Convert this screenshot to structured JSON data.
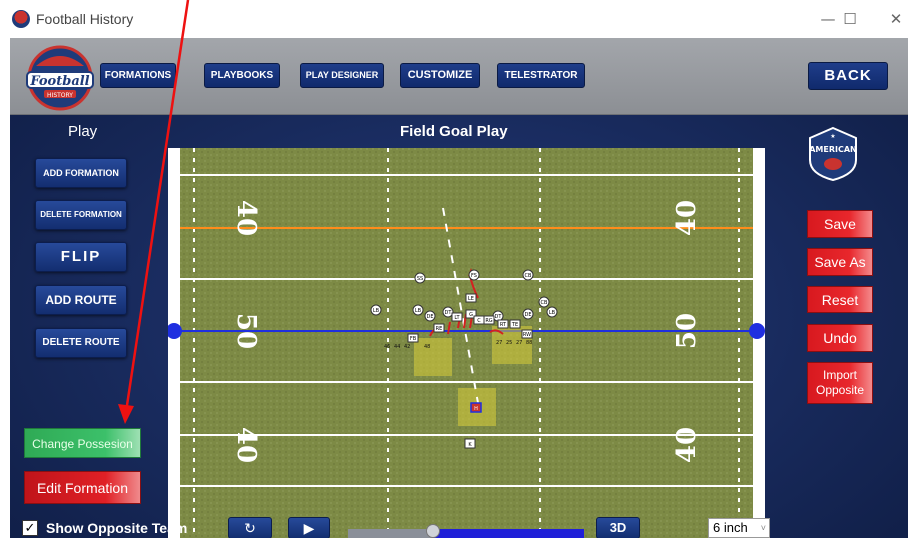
{
  "window": {
    "title": "Football History",
    "minimize": "—",
    "maximize": "☐",
    "close": "✕"
  },
  "logo": {
    "text": "Football",
    "sub": "HISTORY"
  },
  "nav": [
    {
      "label": "FORMATIONS"
    },
    {
      "label": "PLAYBOOKS"
    },
    {
      "label": "PLAY DESIGNER"
    },
    {
      "label": "CUSTOMIZE"
    },
    {
      "label": "TELESTRATOR"
    }
  ],
  "back_label": "BACK",
  "left_heading": "Play",
  "play_title": "Field Goal Play",
  "left_buttons": [
    {
      "label": "ADD FORMATION"
    },
    {
      "label": "DELETE FORMATION"
    },
    {
      "label": "FLIP"
    },
    {
      "label": "ADD ROUTE"
    },
    {
      "label": "DELETE ROUTE"
    }
  ],
  "change_possession": "Change Possesion",
  "edit_formation": "Edit Formation",
  "team_badge": "AMERICAN",
  "right_buttons": [
    {
      "label": "Save"
    },
    {
      "label": "Save As"
    },
    {
      "label": "Reset"
    },
    {
      "label": "Undo"
    },
    {
      "label": "Import Opposite"
    }
  ],
  "field": {
    "yard_numbers_left": [
      "40",
      "50",
      "40"
    ],
    "yard_numbers_right": [
      "40",
      "50",
      "40"
    ],
    "defense_labels": [
      "SS",
      "FS",
      "CB",
      "LB",
      "LB",
      "DE",
      "DE",
      "DT",
      "DT",
      "CB",
      "LB"
    ],
    "offense_labels": [
      "LE",
      "LT",
      "G",
      "C",
      "RG",
      "RT",
      "TE",
      "RE",
      "FB",
      "RW",
      "H",
      "K"
    ],
    "numbers_small": [
      "46",
      "44",
      "42",
      "48"
    ],
    "numbers_small_right": [
      "27",
      "25",
      "27",
      "88"
    ]
  },
  "bottom": {
    "show_opposite": "Show Opposite Team",
    "checked": "✓",
    "btn_3d": "3D",
    "redo_icon": "↻",
    "play_icon": "▶",
    "inch_value": "6 inch"
  },
  "slider_position": 0.36,
  "colors": {
    "field": "#7d8a45",
    "scrimmage_line": "#1f2fe0",
    "first_down_line": "#ff8c1a",
    "save_red": "#e02026",
    "nav_blue": "#14306f",
    "possession_green": "#3cc06a"
  }
}
